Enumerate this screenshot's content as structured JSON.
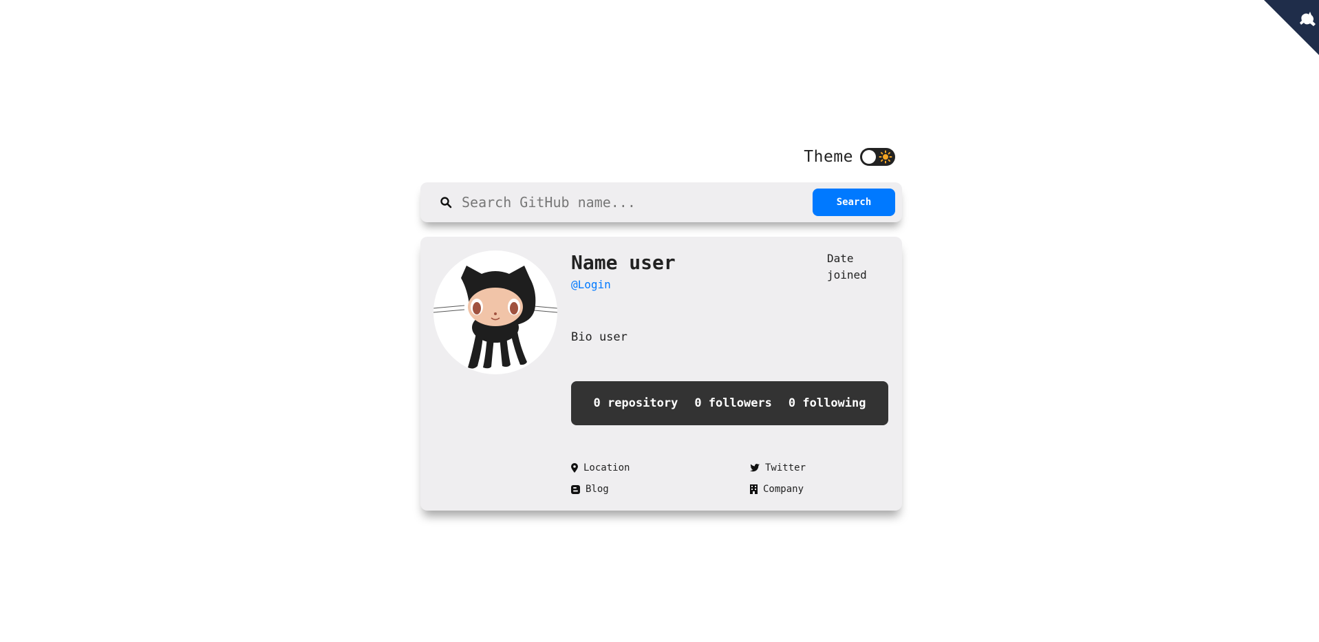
{
  "corner": {
    "icon": "octocat-corner-icon",
    "color": "#1f2d4a"
  },
  "theme": {
    "label": "Theme",
    "toggle_icon": "sun-icon"
  },
  "search": {
    "placeholder": "Search GitHub name...",
    "button_label": "Search",
    "icon": "search-icon",
    "accent": "#0079ff"
  },
  "profile": {
    "avatar_icon": "octocat-avatar",
    "name": "Name user",
    "login": "@Login",
    "joined": "Date joined",
    "bio": "Bio user",
    "stats": {
      "repositories": "0 repository",
      "followers": "0 followers",
      "following": "0 following"
    },
    "links": {
      "location": "Location",
      "twitter": "Twitter",
      "blog": "Blog",
      "company": "Company"
    }
  }
}
